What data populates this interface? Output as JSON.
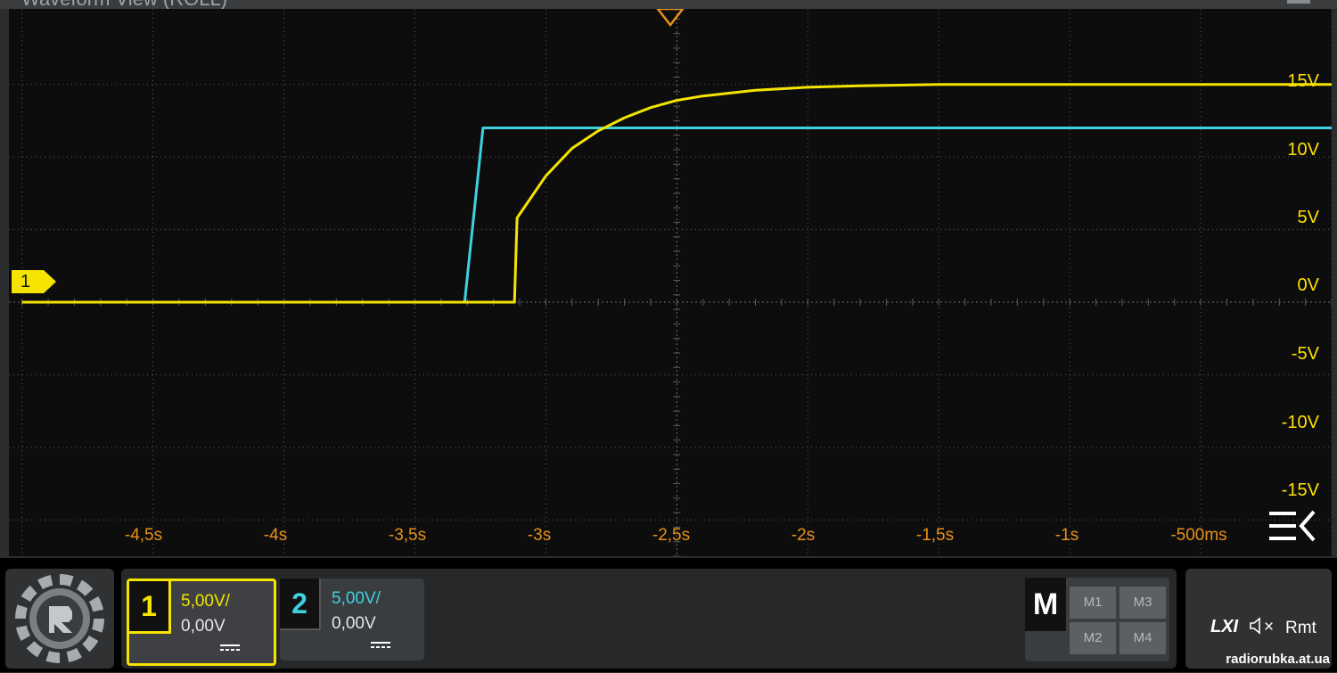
{
  "window": {
    "title": "Waveform View (ROLL)"
  },
  "colors": {
    "ch1": "#f4e400",
    "ch2": "#3fd1df",
    "grid": "#5c5c5c",
    "time_axis_text": "#e8901a",
    "screen_background": "#0e0d0d"
  },
  "icons": {
    "ch1_ground_marker": "channel-1-ground-marker",
    "trigger_marker": "trigger-position-marker",
    "menu_collapse": "menu-collapse-icon",
    "logo": "gear-logo-icon",
    "coupling": "dc-coupling-icon",
    "speaker": "speaker-muted-icon"
  },
  "display": {
    "ch1_marker_label": "1",
    "voltage_labels": [
      "15V",
      "10V",
      "5V",
      "0V",
      "-5V",
      "-10V",
      "-15V"
    ],
    "time_labels": [
      "-4,5s",
      "-4s",
      "-3,5s",
      "-3s",
      "-2,5s",
      "-2s",
      "-1,5s",
      "-1s",
      "-500ms"
    ]
  },
  "chart_data": {
    "type": "line",
    "title": "",
    "xlabel": "",
    "ylabel": "",
    "xlim": [
      -5.05,
      0.0
    ],
    "ylim": [
      -17.5,
      20.2
    ],
    "grid": true,
    "series": [
      {
        "channel": "1",
        "color": "#f4e400",
        "x": [
          -5.0,
          -3.3,
          -3.12,
          -3.11,
          -3.0,
          -2.9,
          -2.8,
          -2.7,
          -2.6,
          -2.5,
          -2.4,
          -2.2,
          -2.0,
          -1.8,
          -1.5,
          -1.2,
          -1.0,
          -0.5,
          0.0
        ],
        "y": [
          0.0,
          0.0,
          0.0,
          5.8,
          8.7,
          10.6,
          11.8,
          12.7,
          13.4,
          13.9,
          14.2,
          14.6,
          14.8,
          14.9,
          15.0,
          15.0,
          15.0,
          15.0,
          15.0
        ]
      },
      {
        "channel": "2",
        "color": "#3fd1df",
        "x": [
          -5.0,
          -3.31,
          -3.24,
          -3.2,
          0.0
        ],
        "y": [
          0.0,
          0.0,
          12.0,
          12.0,
          12.0
        ]
      }
    ]
  },
  "channels": [
    {
      "number": "1",
      "scale": "5,00V/",
      "offset": "0,00V",
      "active": true
    },
    {
      "number": "2",
      "scale": "5,00V/",
      "offset": "0,00V",
      "active": false
    }
  ],
  "math": {
    "label": "M",
    "buttons": [
      "M1",
      "M2",
      "M3",
      "M4"
    ]
  },
  "status": {
    "lxi": "LXI",
    "speaker_state": "×",
    "remote": "Rmt"
  },
  "watermark": "radiorubka.at.ua"
}
